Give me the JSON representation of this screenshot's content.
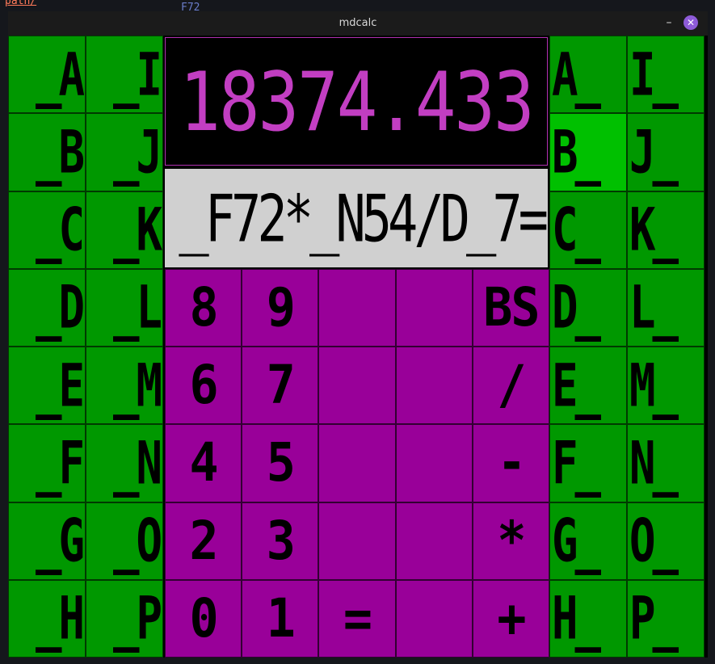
{
  "background": {
    "path_text": "path/",
    "code_text": "F72",
    "path_color": "#ff7a59",
    "code_color": "#6a7cc9"
  },
  "window": {
    "title": "mdcalc",
    "minimize_label": "–",
    "close_label": "✕"
  },
  "display": {
    "value": "18374.433",
    "expression": "_F72*_N54/D_7=",
    "value_color": "#c23ec2"
  },
  "colors": {
    "register_key": "#009800",
    "register_key_active": "#00c000",
    "keypad_key": "#990099",
    "expression_bg": "#d0d0d0"
  },
  "left_registers": [
    "_A",
    "_B",
    "_C",
    "_D",
    "_E",
    "_F",
    "_G",
    "_H",
    "_I",
    "_J",
    "_K",
    "_L",
    "_M",
    "_N",
    "_O",
    "_P"
  ],
  "right_registers": [
    "A_",
    "B_",
    "C_",
    "D_",
    "E_",
    "F_",
    "G_",
    "H_",
    "I_",
    "J_",
    "K_",
    "L_",
    "M_",
    "N_",
    "O_",
    "P_"
  ],
  "active_right_register": "B_",
  "keypad": [
    [
      "8",
      "9",
      "",
      "",
      "BS"
    ],
    [
      "6",
      "7",
      "",
      "",
      "/"
    ],
    [
      "4",
      "5",
      "",
      "",
      "-"
    ],
    [
      "2",
      "3",
      "",
      "",
      "*"
    ],
    [
      "0",
      "1",
      "=",
      "",
      "+"
    ]
  ]
}
